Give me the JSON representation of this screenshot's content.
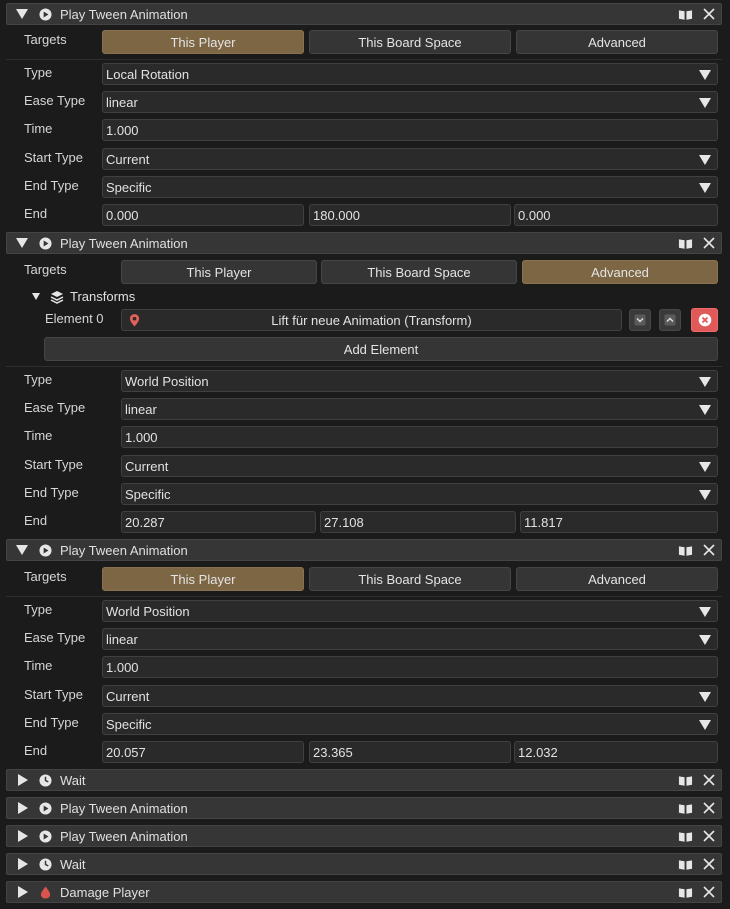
{
  "common": {
    "play_title": "Play Tween Animation",
    "wait_title": "Wait",
    "damage_title": "Damage Player",
    "targets_label": "Targets",
    "target_options": [
      "This Player",
      "This Board Space",
      "Advanced"
    ],
    "type_label": "Type",
    "ease_label": "Ease Type",
    "time_label": "Time",
    "start_label": "Start Type",
    "end_type_label": "End Type",
    "end_label": "End"
  },
  "block1": {
    "active_target": "This Player",
    "type": "Local Rotation",
    "ease": "linear",
    "time": "1.000",
    "start_type": "Current",
    "end_type": "Specific",
    "end": [
      "0.000",
      "180.000",
      "0.000"
    ]
  },
  "block2": {
    "active_target": "Advanced",
    "transforms_label": "Transforms",
    "element_label": "Element 0",
    "element_value": "Lift für neue Animation (Transform)",
    "add_element": "Add Element",
    "type": "World Position",
    "ease": "linear",
    "time": "1.000",
    "start_type": "Current",
    "end_type": "Specific",
    "end": [
      "20.287",
      "27.108",
      "11.817"
    ]
  },
  "block3": {
    "active_target": "This Player",
    "type": "World Position",
    "ease": "linear",
    "time": "1.000",
    "start_type": "Current",
    "end_type": "Specific",
    "end": [
      "20.057",
      "23.365",
      "12.032"
    ]
  },
  "colors": {
    "active_tab": "#7d6644",
    "remove_button": "#e05a5a",
    "location_pin": "#e0605a",
    "damage_drop": "#d9534f"
  }
}
